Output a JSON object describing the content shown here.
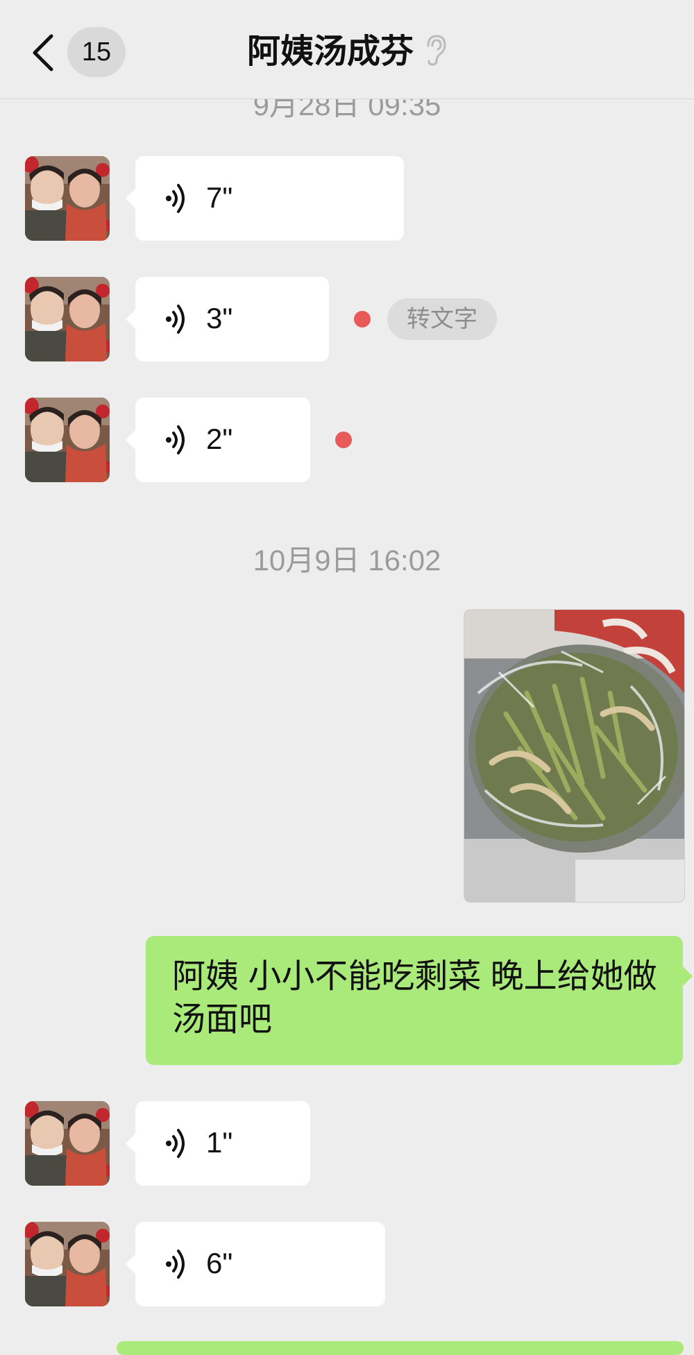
{
  "header": {
    "unread_count": "15",
    "title": "阿姨汤成芬",
    "back_icon": "chevron-left-icon",
    "mode_icon": "ear-icon"
  },
  "timestamps": [
    "9月28日 09:35",
    "10月9日 16:02"
  ],
  "messages": [
    {
      "type": "voice",
      "from": "contact",
      "duration": "7\"",
      "unread": false
    },
    {
      "type": "voice",
      "from": "contact",
      "duration": "3\"",
      "unread": true,
      "action": "转文字"
    },
    {
      "type": "voice",
      "from": "contact",
      "duration": "2\"",
      "unread": true
    },
    {
      "type": "image",
      "from": "me",
      "content": "plastic-wrapped bowl of leftover green vegetables"
    },
    {
      "type": "text",
      "from": "me",
      "text": "阿姨 小小不能吃剩菜 晚上给她做汤面吧"
    },
    {
      "type": "voice",
      "from": "contact",
      "duration": "1\"",
      "unread": false
    },
    {
      "type": "voice",
      "from": "contact",
      "duration": "6\"",
      "unread": false
    }
  ],
  "colors": {
    "background": "#ededed",
    "sent_bubble": "#a9ea7a",
    "received_bubble": "#ffffff",
    "unread_dot": "#e85a5a"
  }
}
